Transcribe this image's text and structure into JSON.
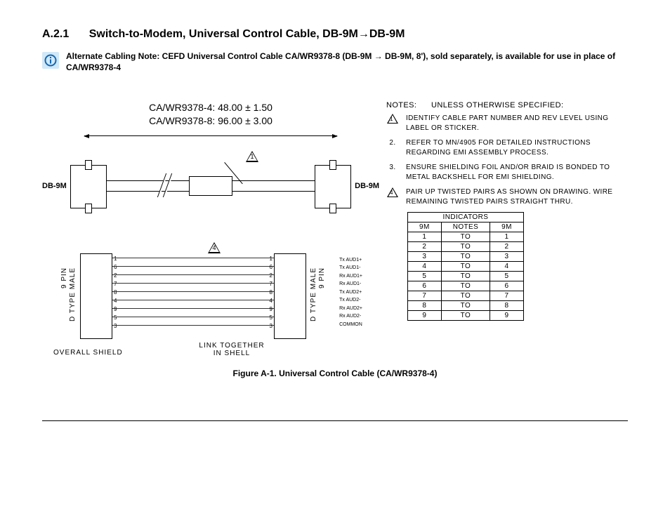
{
  "heading": {
    "section": "A.2.1",
    "title": "Switch-to-Modem, Universal Control Cable, DB-9M→DB-9M"
  },
  "note": {
    "text": "Alternate Cabling Note: CEFD Universal Control Cable CA/WR9378-8 (DB-9M → DB-9M, 8'), sold separately, is available for use in place of CA/WR9378-4"
  },
  "dimensions": {
    "line1": "CA/WR9378-4: 48.00 ± 1.50",
    "line2": "CA/WR9378-8: 96.00 ± 3.00"
  },
  "connectors": {
    "left": "DB-9M",
    "right": "DB-9M",
    "type_line1": "9 PIN",
    "type_line2": "D TYPE MALE"
  },
  "flags": {
    "f1": "1",
    "f4": "4"
  },
  "pinout": {
    "left_pins": "1\n6\n2\n7\n8\n4\n9\n5\n3",
    "right_pins": "1\n6\n2\n7\n8\n4\n9\n5\n3",
    "signals": "Tx AUD1+\nTx AUD1-\nRx AUD1+\nRx AUD1-\nTx AUD2+\nTx AUD2-\nRx AUD2+\nRx AUD2-\nCOMMON",
    "shield": "OVERALL SHIELD",
    "link": "LINK TOGETHER\nIN SHELL"
  },
  "notes_block": {
    "header": "NOTES:",
    "subhead": "UNLESS OTHERWISE SPECIFIED:",
    "items": [
      {
        "num": "1",
        "tri": true,
        "text": "IDENTIFY CABLE PART NUMBER AND REV LEVEL USING LABEL OR STICKER."
      },
      {
        "num": "2.",
        "tri": false,
        "text": "REFER TO MN/4905 FOR DETAILED INSTRUCTIONS REGARDING EMI ASSEMBLY PROCESS."
      },
      {
        "num": "3.",
        "tri": false,
        "text": "ENSURE SHIELDING FOIL AND/OR BRAID IS BONDED TO METAL BACKSHELL FOR EMI SHIELDING."
      },
      {
        "num": "4",
        "tri": true,
        "text": "PAIR UP TWISTED PAIRS AS SHOWN ON DRAWING. WIRE REMAINING TWISTED PAIRS STRAIGHT THRU."
      }
    ]
  },
  "indicators": {
    "title": "INDICATORS",
    "headers": [
      "9M",
      "NOTES",
      "9M"
    ],
    "rows": [
      [
        "1",
        "TO",
        "1"
      ],
      [
        "2",
        "TO",
        "2"
      ],
      [
        "3",
        "TO",
        "3"
      ],
      [
        "4",
        "TO",
        "4"
      ],
      [
        "5",
        "TO",
        "5"
      ],
      [
        "6",
        "TO",
        "6"
      ],
      [
        "7",
        "TO",
        "7"
      ],
      [
        "8",
        "TO",
        "8"
      ],
      [
        "9",
        "TO",
        "9"
      ]
    ]
  },
  "caption": "Figure A-1.  Universal Control Cable (CA/WR9378-4)"
}
